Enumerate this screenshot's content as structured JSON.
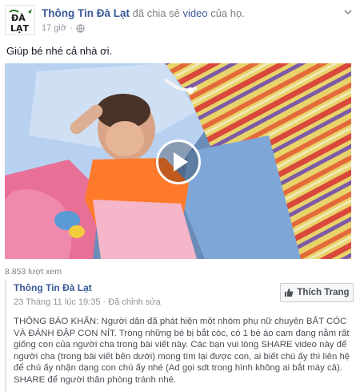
{
  "post": {
    "page_name": "Thông Tin Đà Lạt",
    "action_text": "đã chia sẻ",
    "action_link": "video",
    "action_suffix": "của họ.",
    "time": "17 giờ",
    "time_separator": "·",
    "caption": "Giúp bé nhé cả nhà ơi.",
    "avatar_text_top": "ĐÀ",
    "avatar_text_bottom": "LẠT"
  },
  "video": {
    "views": "8.853 lượt xem",
    "play_icon": "play-icon"
  },
  "shared": {
    "page_name": "Thông Tin Đà Lạt",
    "date": "23 Tháng 11 lúc 19:35",
    "separator": "·",
    "edited": "Đã chỉnh sửa",
    "like_button": "Thích Trang",
    "body": "THÔNG BÁO KHẨN: Người dân đã phát hiện một nhóm phụ nữ chuyên BẮT CÓC VÀ ĐÁNH ĐẬP CON NÍT. Trong những bé bị bắt cóc, có 1 bé áo cam đang nằm rất giống con của người cha trong bài viết này. Các bạn vui lòng SHARE video này để người cha (trong bài viết bên dưới) mong tìm lại được con, ai biết chú ấy thì liên hệ để chú ấy nhận dạng con chú ấy nhé (Ad gọi sdt trong hình không ai bắt máy cả). SHARE để người thân phòng tránh nhé."
  },
  "colors": {
    "link": "#3b5998",
    "meta": "#90949c",
    "text": "#141823"
  }
}
